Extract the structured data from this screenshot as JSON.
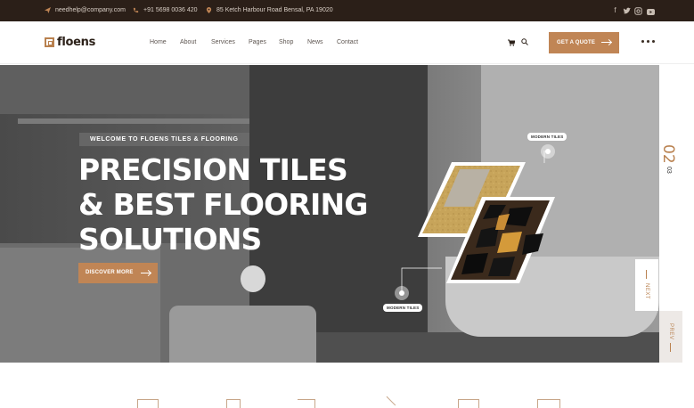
{
  "topbar": {
    "email": "needhelp@company.com",
    "phone": "+91 5698 0036 420",
    "address": "85 Ketch Harbour Road Bensal, PA 19020",
    "social": [
      "facebook-icon",
      "twitter-icon",
      "instagram-icon",
      "youtube-icon"
    ]
  },
  "header": {
    "logo_text": "floens",
    "nav": [
      "Home",
      "About",
      "Services",
      "Pages",
      "Shop",
      "News",
      "Contact"
    ],
    "quote_label": "GET A QUOTE"
  },
  "hero": {
    "tagline": "WELCOME TO FLOENS TILES & FLOORING",
    "title_lines": [
      "PRECISION TILES",
      "& BEST FLOORING",
      "SOLUTIONS"
    ],
    "cta_label": "DISCOVER MORE",
    "hotspot_labels": [
      "MODERN TILES",
      "MODERN TILES"
    ]
  },
  "slider": {
    "current": "02",
    "total": "03",
    "next_label": "NEXT",
    "prev_label": "PREV"
  },
  "colors": {
    "brand": "#c08555",
    "topbar_bg": "#2b1f18",
    "accent_text": "#b9814f"
  }
}
